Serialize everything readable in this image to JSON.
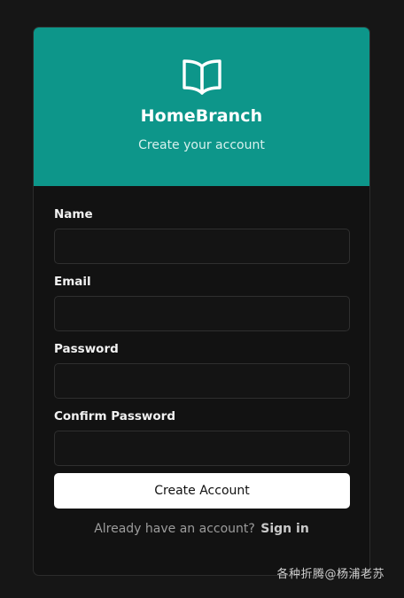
{
  "header": {
    "logo_icon": "open-book-icon",
    "title": "HomeBranch",
    "subtitle": "Create your account",
    "bg_color": "#0d968a"
  },
  "form": {
    "fields": [
      {
        "label": "Name",
        "value": "",
        "placeholder": ""
      },
      {
        "label": "Email",
        "value": "",
        "placeholder": ""
      },
      {
        "label": "Password",
        "value": "",
        "placeholder": ""
      },
      {
        "label": "Confirm Password",
        "value": "",
        "placeholder": ""
      }
    ],
    "submit_label": "Create Account"
  },
  "footer": {
    "prompt": "Already have an account?",
    "link_label": "Sign in"
  },
  "watermark": "各种折腾@杨浦老苏"
}
